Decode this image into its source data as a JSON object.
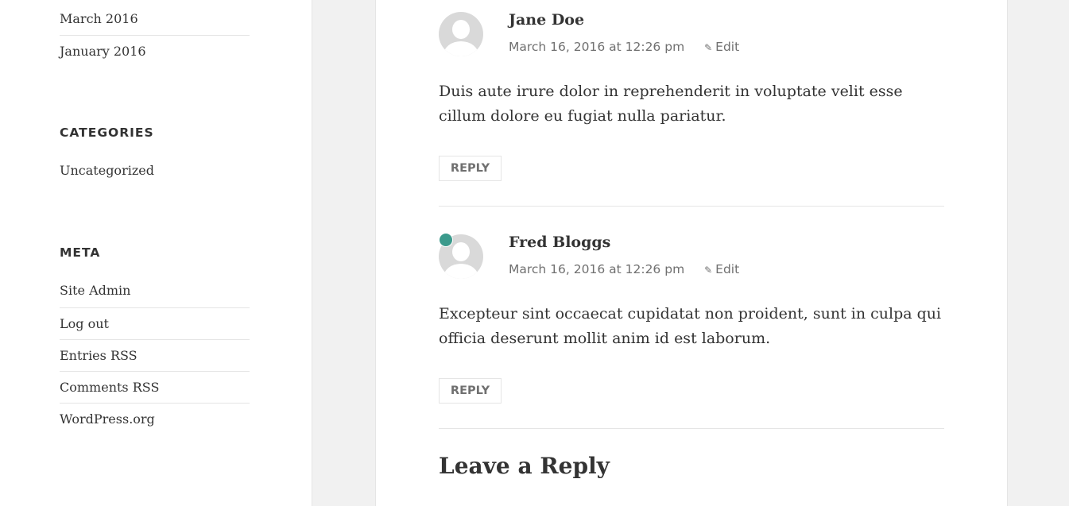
{
  "sidebar": {
    "archives": [
      "March 2016",
      "January 2016"
    ],
    "categories": {
      "title": "CATEGORIES",
      "items": [
        "Uncategorized"
      ]
    },
    "meta": {
      "title": "META",
      "items": [
        "Site Admin",
        "Log out",
        "Entries RSS",
        "Comments RSS",
        "WordPress.org"
      ]
    }
  },
  "comments": [
    {
      "author": "Jane Doe",
      "date": "March 16, 2016 at 12:26 pm",
      "edit_label": "Edit",
      "text": "Duis aute irure dolor in reprehenderit in voluptate velit esse cillum dolore eu fugiat nulla pariatur.",
      "reply_label": "REPLY",
      "avatar_icon": "user-avatar-icon"
    },
    {
      "author": "Fred Bloggs",
      "date": "March 16, 2016 at 12:26 pm",
      "edit_label": "Edit",
      "text": "Excepteur sint occaecat cupidatat non proident, sunt in culpa qui officia deserunt mollit anim id est laborum.",
      "reply_label": "REPLY",
      "avatar_icon": "user-avatar-icon",
      "badge_color": "#3b9a8c"
    }
  ],
  "respond": {
    "title": "Leave a Reply"
  },
  "colors": {
    "background": "#f1f1f1",
    "text": "#333333",
    "meta_text": "#707070",
    "border": "#e5e5e5",
    "author_badge": "#3b9a8c"
  }
}
